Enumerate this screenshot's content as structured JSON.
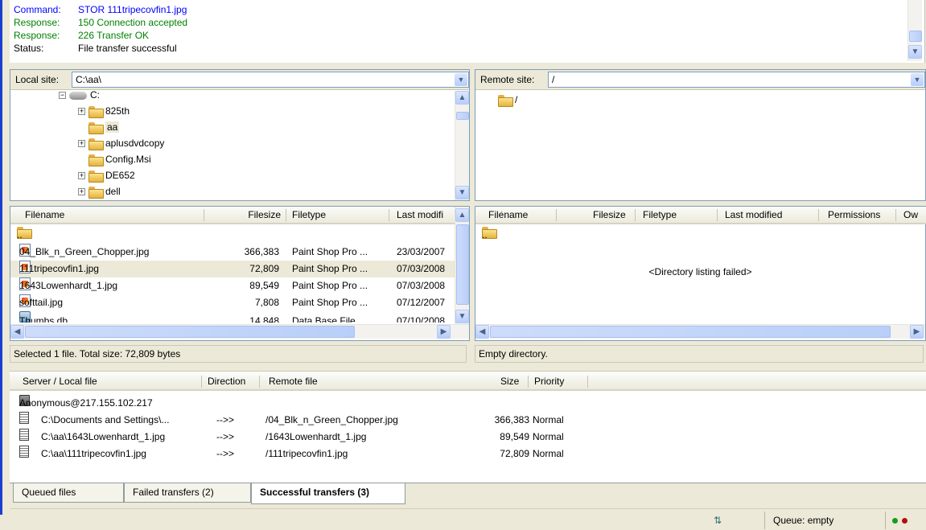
{
  "log": [
    {
      "label": "Command:",
      "text": "STOR 111tripecovfin1.jpg",
      "color": "blue"
    },
    {
      "label": "Response:",
      "text": "150 Connection accepted",
      "color": "green"
    },
    {
      "label": "Response:",
      "text": "226 Transfer OK",
      "color": "green"
    },
    {
      "label": "Status:",
      "text": "File transfer successful",
      "color": "black"
    }
  ],
  "local": {
    "site_label": "Local site:",
    "path": "C:\\aa\\",
    "tree": [
      {
        "label": "C:",
        "type": "drive",
        "expander": "−"
      },
      {
        "label": "825th",
        "type": "folder",
        "expander": "+"
      },
      {
        "label": "aa",
        "type": "folder",
        "expander": "",
        "selected": true
      },
      {
        "label": "aplusdvdcopy",
        "type": "folder",
        "expander": "+"
      },
      {
        "label": "Config.Msi",
        "type": "folder",
        "expander": ""
      },
      {
        "label": "DE652",
        "type": "folder",
        "expander": "+"
      },
      {
        "label": "dell",
        "type": "folder",
        "expander": "+"
      }
    ],
    "columns": [
      "Filename",
      "Filesize",
      "Filetype",
      "Last modifi"
    ],
    "sort_indicator": "/",
    "files": [
      {
        "name": "..",
        "size": "",
        "type": "",
        "modified": "",
        "icon": "folder"
      },
      {
        "name": "04_Blk_n_Green_Chopper.jpg",
        "size": "366,383",
        "type": "Paint Shop Pro ...",
        "modified": "23/03/2007",
        "icon": "image"
      },
      {
        "name": "111tripecovfin1.jpg",
        "size": "72,809",
        "type": "Paint Shop Pro ...",
        "modified": "07/03/2008",
        "icon": "image",
        "selected": true
      },
      {
        "name": "1643Lowenhardt_1.jpg",
        "size": "89,549",
        "type": "Paint Shop Pro ...",
        "modified": "07/03/2008",
        "icon": "image"
      },
      {
        "name": "softtail.jpg",
        "size": "7,808",
        "type": "Paint Shop Pro ...",
        "modified": "07/12/2007",
        "icon": "image"
      },
      {
        "name": "Thumbs.db",
        "size": "14,848",
        "type": "Data Base File",
        "modified": "07/10/2008",
        "icon": "db"
      }
    ],
    "status": "Selected 1 file. Total size: 72,809 bytes"
  },
  "remote": {
    "site_label": "Remote site:",
    "path": "/",
    "tree": [
      {
        "label": "/",
        "type": "folder"
      }
    ],
    "columns": [
      "Filename",
      "Filesize",
      "Filetype",
      "Last modified",
      "Permissions",
      "Ow"
    ],
    "sort_indicator": "/",
    "files": [
      {
        "name": "..",
        "icon": "folder"
      }
    ],
    "message": "<Directory listing failed>",
    "status": "Empty directory."
  },
  "queue": {
    "columns": [
      "Server / Local file",
      "Direction",
      "Remote file",
      "Size",
      "Priority"
    ],
    "server": "Anonymous@217.155.102.217",
    "items": [
      {
        "local": "C:\\Documents and Settings\\...",
        "direction": "-->>",
        "remote": "/04_Blk_n_Green_Chopper.jpg",
        "size": "366,383",
        "priority": "Normal"
      },
      {
        "local": "C:\\aa\\1643Lowenhardt_1.jpg",
        "direction": "-->>",
        "remote": "/1643Lowenhardt_1.jpg",
        "size": "89,549",
        "priority": "Normal"
      },
      {
        "local": "C:\\aa\\111tripecovfin1.jpg",
        "direction": "-->>",
        "remote": "/111tripecovfin1.jpg",
        "size": "72,809",
        "priority": "Normal"
      }
    ]
  },
  "tabs": [
    {
      "label": "Queued files",
      "active": false
    },
    {
      "label": "Failed transfers (2)",
      "active": false
    },
    {
      "label": "Successful transfers (3)",
      "active": true
    }
  ],
  "statusbar": {
    "queue": "Queue: empty",
    "led_colors": [
      "#1a9a1a",
      "#b01010"
    ]
  },
  "colors": {
    "selected_row": "#ece9d8",
    "log_blue": "#0000ff",
    "log_green": "#008000"
  }
}
